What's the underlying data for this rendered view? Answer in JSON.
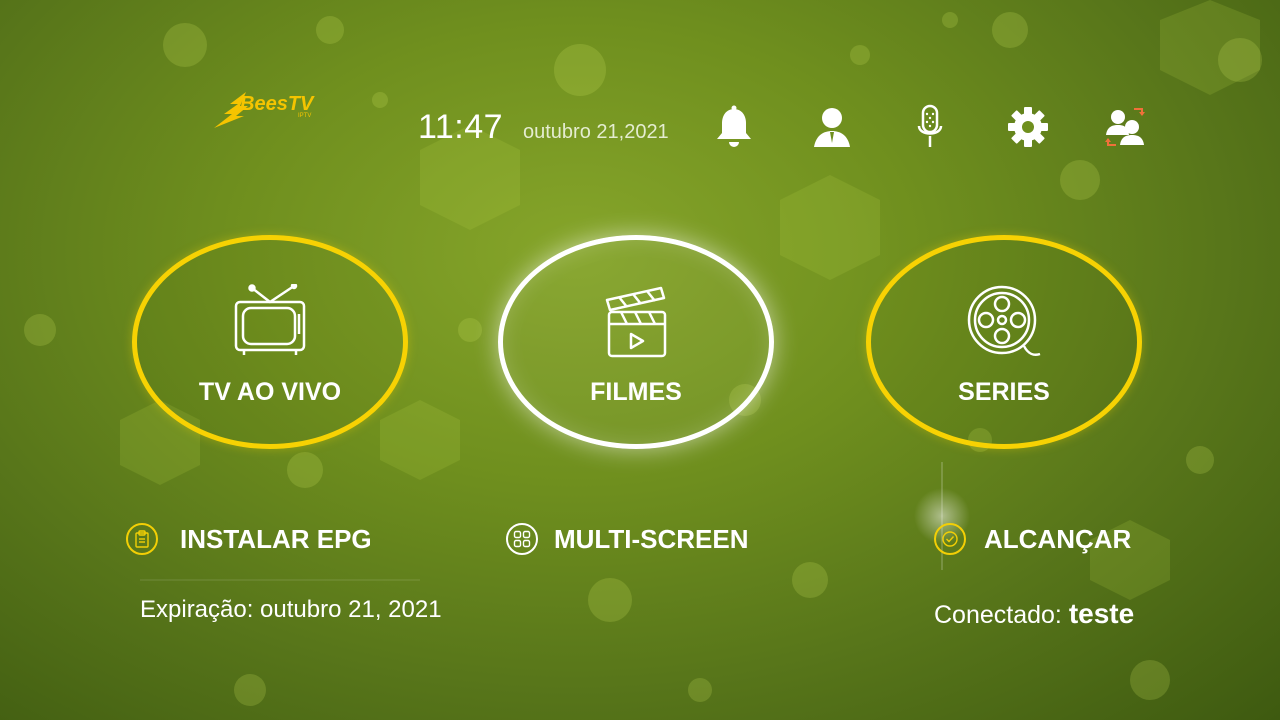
{
  "header": {
    "brand": "BeesTV",
    "brand_sub": "IPTV",
    "time": "11:47",
    "date": "outubro 21,2021",
    "icons": [
      "bell-icon",
      "user-icon",
      "microphone-icon",
      "gear-icon",
      "switch-user-icon"
    ]
  },
  "tiles": [
    {
      "label": "TV AO VIVO",
      "icon": "tv-icon",
      "selected": false
    },
    {
      "label": "FILMES",
      "icon": "clapperboard-icon",
      "selected": true
    },
    {
      "label": "SERIES",
      "icon": "film-reel-icon",
      "selected": false
    }
  ],
  "actions": [
    {
      "label": "INSTALAR EPG",
      "icon": "clipboard-icon"
    },
    {
      "label": "MULTI-SCREEN",
      "icon": "grid-icon"
    },
    {
      "label": "ALCANÇAR",
      "icon": "check-circle-icon"
    }
  ],
  "footer": {
    "expiration": "Expiração: outubro 21, 2021",
    "connected_label": "Conectado:",
    "connected_user": "teste"
  },
  "colors": {
    "accent_yellow": "#f7d203",
    "background_green": "#6f8f1e",
    "selected_ring": "#ffffff"
  }
}
